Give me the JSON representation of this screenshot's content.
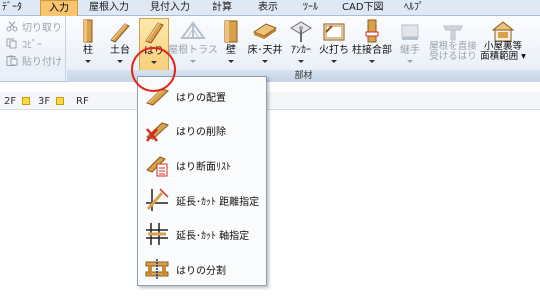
{
  "menu": {
    "tabs": [
      {
        "label": "ﾃﾞｰﾀ",
        "active": false
      },
      {
        "label": "入力",
        "active": true
      },
      {
        "label": "屋根入力",
        "active": false
      },
      {
        "label": "見付入力",
        "active": false
      },
      {
        "label": "計算",
        "active": false
      },
      {
        "label": "表示",
        "active": false
      },
      {
        "label": "ﾂｰﾙ",
        "active": false
      },
      {
        "label": "CAD下図",
        "active": false
      },
      {
        "label": "ﾍﾙﾌﾟ",
        "active": false
      }
    ]
  },
  "clipboard": {
    "cut": "切り取り",
    "copy": "ｺﾋﾟｰ",
    "paste": "貼り付け"
  },
  "ribbon": {
    "buttons": [
      {
        "label": "柱",
        "icon": "pillar-icon"
      },
      {
        "label": "土台",
        "icon": "sill-icon"
      },
      {
        "label": "はり",
        "icon": "beam-icon",
        "pressed": true
      },
      {
        "label": "屋根トラス",
        "icon": "roof-truss-icon",
        "disabled": true
      },
      {
        "label": "壁",
        "icon": "wall-icon"
      },
      {
        "label": "床･天井",
        "icon": "floor-ceiling-icon"
      },
      {
        "label": "ｱﾝｶｰ",
        "icon": "anchor-icon"
      },
      {
        "label": "火打ち",
        "icon": "brace-icon"
      },
      {
        "label": "柱接合部",
        "icon": "column-joint-icon"
      },
      {
        "label": "継手",
        "icon": "joint-icon",
        "disabled": true
      },
      {
        "label1": "屋根を直接",
        "label2": "受けるはり",
        "icon": "roof-beam-icon",
        "disabled": true
      },
      {
        "label1": "小屋裏等",
        "label2": "面積範囲",
        "icon": "attic-area-icon"
      }
    ],
    "group_label": "部材"
  },
  "floors": [
    "2F",
    "3F",
    "RF"
  ],
  "dropdown": {
    "items": [
      {
        "label": "はりの配置",
        "icon": "beam-place-icon"
      },
      {
        "label": "はりの削除",
        "icon": "beam-delete-icon"
      },
      {
        "label": "はり断面ﾘｽﾄ",
        "icon": "beam-section-list-icon"
      },
      {
        "label": "延長･ｶｯﾄ 距離指定",
        "icon": "extend-cut-distance-icon"
      },
      {
        "label": "延長･ｶｯﾄ 軸指定",
        "icon": "extend-cut-axis-icon"
      },
      {
        "label": "はりの分割",
        "icon": "beam-split-icon"
      }
    ]
  },
  "colors": {
    "wood": "#d9a14a",
    "highlight": "#e2261c",
    "active_tab": "#f7c56f"
  }
}
